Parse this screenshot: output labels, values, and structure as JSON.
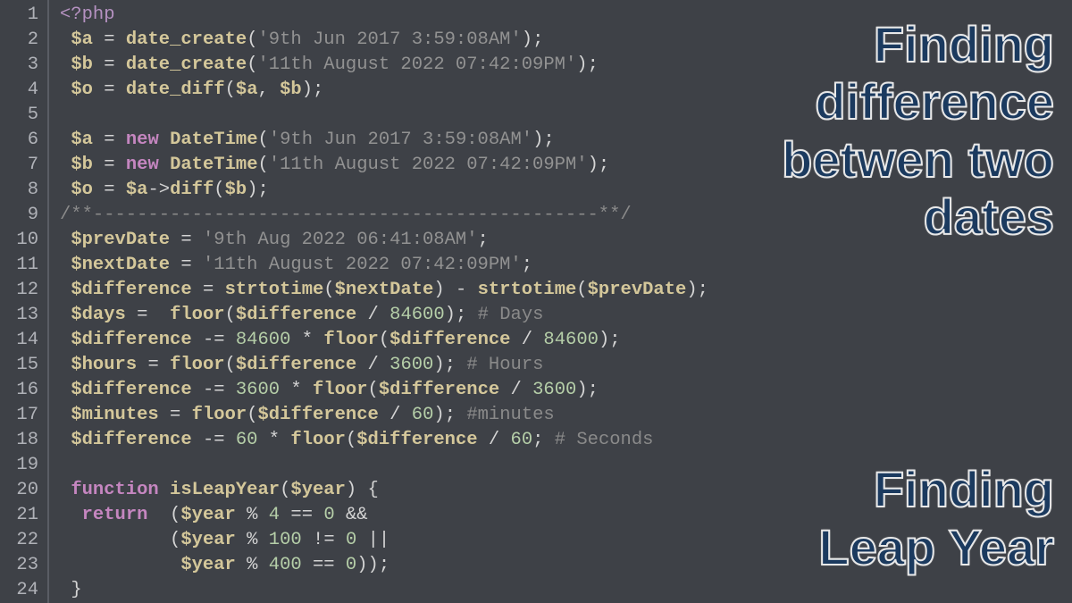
{
  "lines": [
    {
      "n": "1",
      "html": "<span class='php-open'>&lt;?php</span>"
    },
    {
      "n": "2",
      "html": " <span class='var'>$a</span> <span class='op'>=</span> <span class='fn'>date_create</span><span class='paren'>(</span><span class='str'>'9th Jun 2017 3:59:08AM'</span><span class='paren'>)</span><span class='punc'>;</span>"
    },
    {
      "n": "3",
      "html": " <span class='var'>$b</span> <span class='op'>=</span> <span class='fn'>date_create</span><span class='paren'>(</span><span class='str'>'11th August 2022 07:42:09PM'</span><span class='paren'>)</span><span class='punc'>;</span>"
    },
    {
      "n": "4",
      "html": " <span class='var'>$o</span> <span class='op'>=</span> <span class='fn'>date_diff</span><span class='paren'>(</span><span class='var'>$a</span><span class='punc'>,</span> <span class='var'>$b</span><span class='paren'>)</span><span class='punc'>;</span>"
    },
    {
      "n": "5",
      "html": ""
    },
    {
      "n": "6",
      "html": " <span class='var'>$a</span> <span class='op'>=</span> <span class='kw'>new</span> <span class='fn'>DateTime</span><span class='paren'>(</span><span class='str'>'9th Jun 2017 3:59:08AM'</span><span class='paren'>)</span><span class='punc'>;</span>"
    },
    {
      "n": "7",
      "html": " <span class='var'>$b</span> <span class='op'>=</span> <span class='kw'>new</span> <span class='fn'>DateTime</span><span class='paren'>(</span><span class='str'>'11th August 2022 07:42:09PM'</span><span class='paren'>)</span><span class='punc'>;</span>"
    },
    {
      "n": "8",
      "html": " <span class='var'>$o</span> <span class='op'>=</span> <span class='var'>$a</span><span class='op'>-&gt;</span><span class='fn'>diff</span><span class='paren'>(</span><span class='var'>$b</span><span class='paren'>)</span><span class='punc'>;</span>"
    },
    {
      "n": "9",
      "html": "<span class='comment'>/**----------------------------------------------**/</span>"
    },
    {
      "n": "10",
      "html": " <span class='var'>$prevDate</span> <span class='op'>=</span> <span class='str'>'9th Aug 2022 06:41:08AM'</span><span class='punc'>;</span>"
    },
    {
      "n": "11",
      "html": " <span class='var'>$nextDate</span> <span class='op'>=</span> <span class='str'>'11th August 2022 07:42:09PM'</span><span class='punc'>;</span>"
    },
    {
      "n": "12",
      "html": " <span class='var'>$difference</span> <span class='op'>=</span> <span class='fn'>strtotime</span><span class='paren'>(</span><span class='var'>$nextDate</span><span class='paren'>)</span> <span class='op'>-</span> <span class='fn'>strtotime</span><span class='paren'>(</span><span class='var'>$prevDate</span><span class='paren'>)</span><span class='punc'>;</span>"
    },
    {
      "n": "13",
      "html": " <span class='var'>$days</span> <span class='op'>=</span>  <span class='fn'>floor</span><span class='paren'>(</span><span class='var'>$difference</span> <span class='op'>/</span> <span class='num'>84600</span><span class='paren'>)</span><span class='punc'>;</span> <span class='comment'># Days</span>"
    },
    {
      "n": "14",
      "html": " <span class='var'>$difference</span> <span class='op'>-=</span> <span class='num'>84600</span> <span class='op'>*</span> <span class='fn'>floor</span><span class='paren'>(</span><span class='var'>$difference</span> <span class='op'>/</span> <span class='num'>84600</span><span class='paren'>)</span><span class='punc'>;</span>"
    },
    {
      "n": "15",
      "html": " <span class='var'>$hours</span> <span class='op'>=</span> <span class='fn'>floor</span><span class='paren'>(</span><span class='var'>$difference</span> <span class='op'>/</span> <span class='num'>3600</span><span class='paren'>)</span><span class='punc'>;</span> <span class='comment'># Hours</span>"
    },
    {
      "n": "16",
      "html": " <span class='var'>$difference</span> <span class='op'>-=</span> <span class='num'>3600</span> <span class='op'>*</span> <span class='fn'>floor</span><span class='paren'>(</span><span class='var'>$difference</span> <span class='op'>/</span> <span class='num'>3600</span><span class='paren'>)</span><span class='punc'>;</span>"
    },
    {
      "n": "17",
      "html": " <span class='var'>$minutes</span> <span class='op'>=</span> <span class='fn'>floor</span><span class='paren'>(</span><span class='var'>$difference</span> <span class='op'>/</span> <span class='num'>60</span><span class='paren'>)</span><span class='punc'>;</span> <span class='comment'>#minutes</span>"
    },
    {
      "n": "18",
      "html": " <span class='var'>$difference</span> <span class='op'>-=</span> <span class='num'>60</span> <span class='op'>*</span> <span class='fn'>floor</span><span class='paren'>(</span><span class='var'>$difference</span> <span class='op'>/</span> <span class='num'>60</span><span class='punc'>;</span> <span class='comment'># Seconds</span>"
    },
    {
      "n": "19",
      "html": ""
    },
    {
      "n": "20",
      "html": " <span class='kw'>function</span> <span class='fn'>isLeapYear</span><span class='paren'>(</span><span class='var'>$year</span><span class='paren'>)</span> <span class='paren'>{</span>"
    },
    {
      "n": "21",
      "html": "  <span class='kw'>return</span>  <span class='paren'>(</span><span class='var'>$year</span> <span class='op'>%</span> <span class='num'>4</span> <span class='op'>==</span> <span class='num'>0</span> <span class='op'>&amp;&amp;</span>"
    },
    {
      "n": "22",
      "html": "          <span class='paren'>(</span><span class='var'>$year</span> <span class='op'>%</span> <span class='num'>100</span> <span class='op'>!=</span> <span class='num'>0</span> <span class='op'>||</span>"
    },
    {
      "n": "23",
      "html": "           <span class='var'>$year</span> <span class='op'>%</span> <span class='num'>400</span> <span class='op'>==</span> <span class='num'>0</span><span class='paren'>))</span><span class='punc'>;</span>"
    },
    {
      "n": "24",
      "html": " <span class='paren'>}</span>"
    }
  ],
  "overlay1": {
    "l1": "Finding",
    "l2": "difference",
    "l3": "betwen two",
    "l4": "dates"
  },
  "overlay2": {
    "l1": "Finding",
    "l2": "Leap Year"
  }
}
